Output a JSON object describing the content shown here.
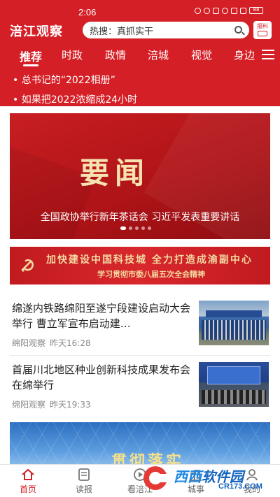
{
  "status": {
    "time": "2:06",
    "battery": "88"
  },
  "app": {
    "logo": "涪江观察"
  },
  "search": {
    "text": "热搜：真抓实干"
  },
  "report": {
    "label": "报料"
  },
  "tabs": [
    {
      "label": "推荐"
    },
    {
      "label": "时政"
    },
    {
      "label": "政情"
    },
    {
      "label": "涪城"
    },
    {
      "label": "视觉"
    },
    {
      "label": "身边"
    }
  ],
  "ticker": [
    {
      "text": "总书记的“2022相册”"
    },
    {
      "text": "如果把2022浓缩成24小时"
    }
  ],
  "banner": {
    "headline": "要闻",
    "caption": "全国政协举行新年茶话会  习近平发表重要讲话",
    "slide_count": 5,
    "active_slide": 1
  },
  "promo": {
    "line1": "加快建设中国科技城 全力打造成渝副中心",
    "line2": "学习贯彻市委八届五次全会精神"
  },
  "news": [
    {
      "title": "绵遂内铁路绵阳至遂宁段建设启动大会举行  曹立军宣布启动建…",
      "source": "绵阳观察",
      "time": "昨天16:28"
    },
    {
      "title": "首届川北地区种业创新科技成果发布会在绵举行",
      "source": "绵阳观察",
      "time": "昨天19:33"
    }
  ],
  "bottom_banner": {
    "text": "贯彻落实"
  },
  "nav": [
    {
      "label": "首页"
    },
    {
      "label": "读报"
    },
    {
      "label": "看涪江"
    },
    {
      "label": "城事"
    },
    {
      "label": "我的"
    }
  ],
  "watermark": {
    "brand": "西西",
    "brand2": "软件园",
    "domain": "CR173.COM"
  },
  "colors": {
    "brand_red": "#d51f26",
    "gold": "#f3d9a0"
  }
}
